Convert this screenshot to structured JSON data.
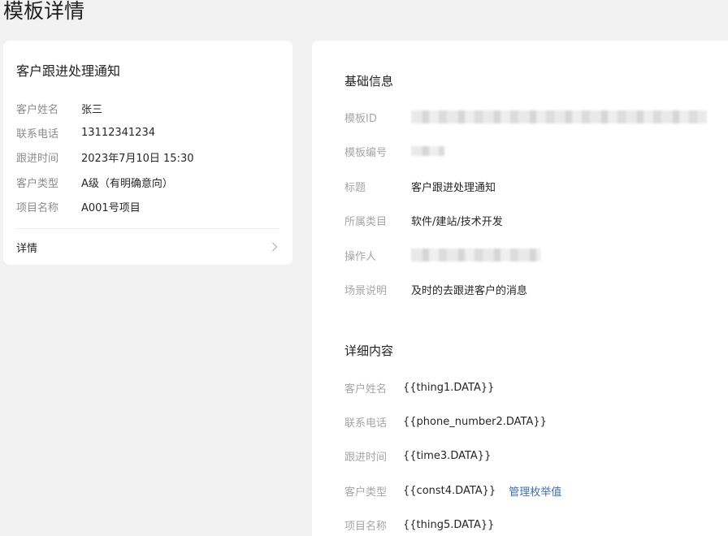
{
  "page": {
    "title": "模板详情"
  },
  "preview": {
    "title": "客户跟进处理通知",
    "fields": [
      {
        "label": "客户姓名",
        "value": "张三"
      },
      {
        "label": "联系电话",
        "value": "13112341234"
      },
      {
        "label": "跟进时间",
        "value": "2023年7月10日 15:30"
      },
      {
        "label": "客户类型",
        "value": "A级（有明确意向）"
      },
      {
        "label": "项目名称",
        "value": "A001号项目"
      }
    ],
    "detail_label": "详情",
    "detail_icon": "chevron-right-icon"
  },
  "basic_info": {
    "title": "基础信息",
    "template_id_label": "模板ID",
    "template_no_label": "模板编号",
    "title_label": "标题",
    "title_value": "客户跟进处理通知",
    "category_label": "所属类目",
    "category_value": "软件/建站/技术开发",
    "operator_label": "操作人",
    "scene_label": "场景说明",
    "scene_value": "及时的去跟进客户的消息"
  },
  "detail_content": {
    "title": "详细内容",
    "rows": [
      {
        "label": "客户姓名",
        "value": "{{thing1.DATA}}"
      },
      {
        "label": "联系电话",
        "value": "{{phone_number2.DATA}}"
      },
      {
        "label": "跟进时间",
        "value": "{{time3.DATA}}"
      },
      {
        "label": "客户类型",
        "value": "{{const4.DATA}}",
        "action": "管理枚举值"
      },
      {
        "label": "项目名称",
        "value": "{{thing5.DATA}}"
      }
    ]
  },
  "colors": {
    "link": "#3f6fb0",
    "page_bg": "#f2f2f2"
  }
}
